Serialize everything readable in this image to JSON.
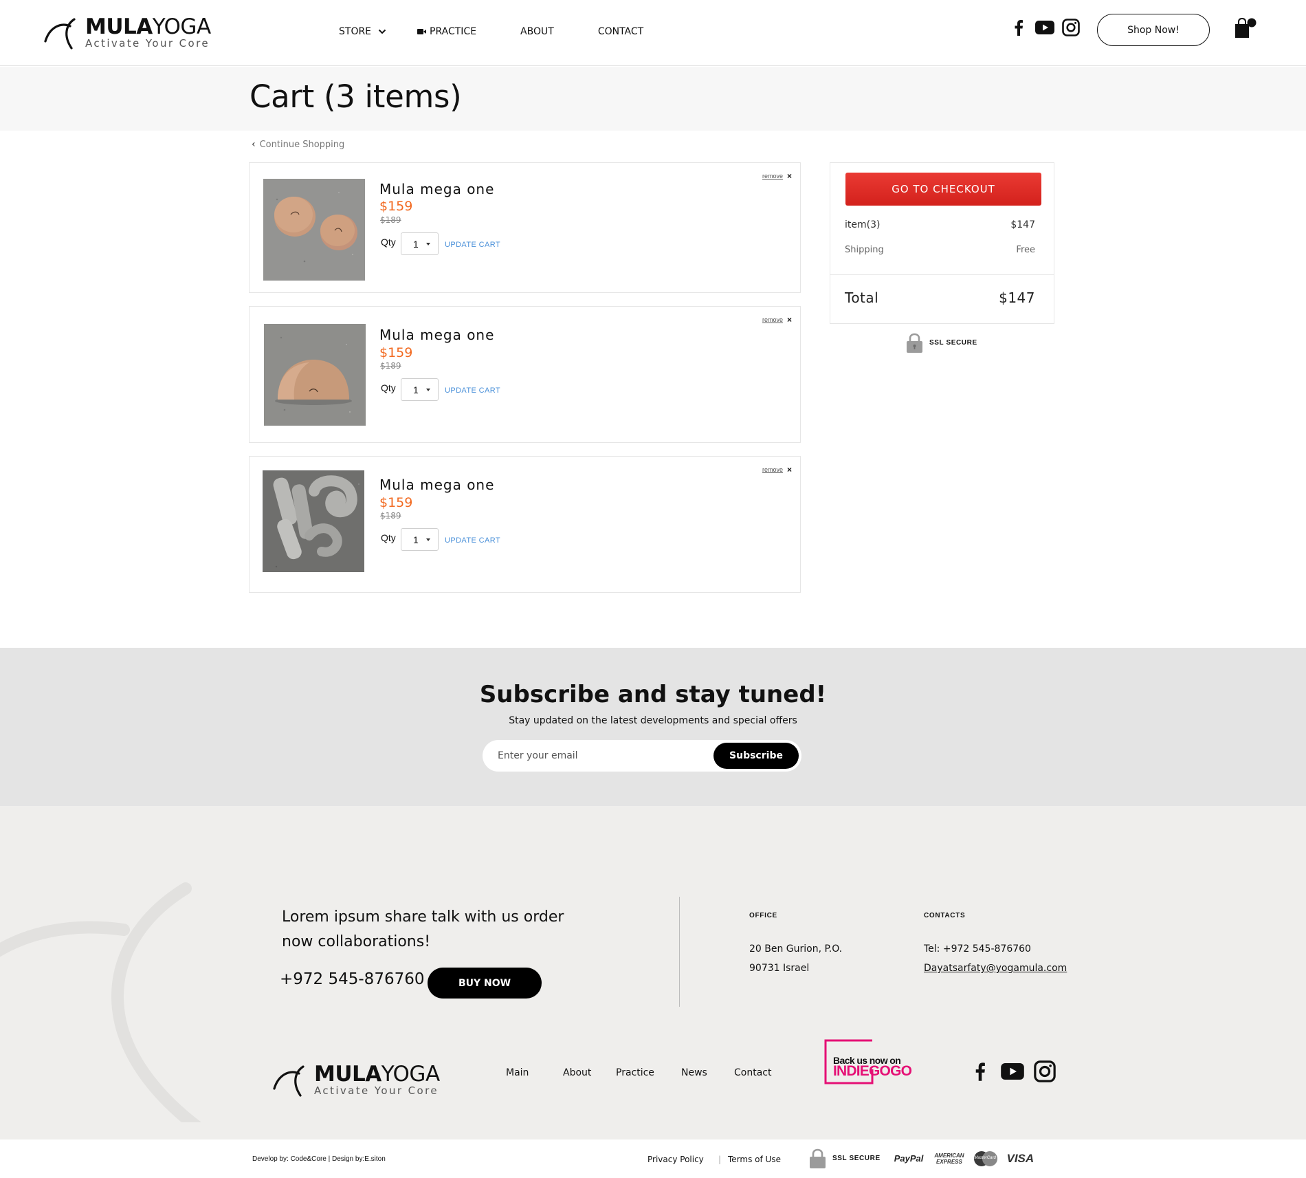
{
  "header": {
    "logo": {
      "brand_bold": "MULA",
      "brand_light": "YOGA",
      "tagline": "Activate Your Core"
    },
    "nav": {
      "store": "STORE",
      "practice": "PRACTICE",
      "about": "ABOUT",
      "contact": "CONTACT"
    },
    "social_icons": [
      "facebook-icon",
      "youtube-icon",
      "instagram-icon"
    ],
    "shop_button": "Shop Now!",
    "cart_icon": "shopping-bag-icon"
  },
  "cart": {
    "title": "Cart (3 items)",
    "continue_label": "Continue Shopping",
    "items": [
      {
        "name": "Mula mega one",
        "price": "$159",
        "old_price": "$189",
        "qty_label": "Qty",
        "qty": "1",
        "update_label": "UPDATE CART",
        "remove_label": "remove",
        "remove_icon": "×",
        "image": "cork balls on concrete"
      },
      {
        "name": "Mula mega one",
        "price": "$159",
        "old_price": "$189",
        "qty_label": "Qty",
        "qty": "1",
        "update_label": "UPDATE CART",
        "remove_label": "remove",
        "remove_icon": "×",
        "image": "cork half-moon block on concrete"
      },
      {
        "name": "Mula mega one",
        "price": "$159",
        "old_price": "$189",
        "qty_label": "Qty",
        "qty": "1",
        "update_label": "UPDATE CART",
        "remove_label": "remove",
        "remove_icon": "×",
        "image": "grey fabric bolsters on concrete"
      }
    ]
  },
  "summary": {
    "checkout_label": "GO TO CHECKOUT",
    "items_label": "item(3)",
    "items_value": "$147",
    "shipping_label": "Shipping",
    "shipping_value": "Free",
    "total_label": "Total",
    "total_value": "$147",
    "ssl_label": "SSL SECURE"
  },
  "subscribe": {
    "title": "Subscribe and stay tuned!",
    "description": "Stay updated on the latest developments and special offers",
    "email_placeholder": "Enter your email",
    "button_label": "Subscribe"
  },
  "footer": {
    "lead_text": "Lorem ipsum share talk with us order now collaborations!",
    "phone": "+972 545-876760",
    "buy_label": "BUY NOW",
    "office_heading": "OFFICE",
    "office_line1": "20 Ben Gurion, P.O.",
    "office_line2": "90731 Israel",
    "contacts_heading": "CONTACTS",
    "contacts_tel": "Tel: +972 545-876760",
    "contacts_email": "Dayatsarfaty@yogamula.com",
    "nav": [
      "Main",
      "About",
      "Practice",
      "News",
      "Contact"
    ],
    "indiegogo_line1": "Back us now on",
    "indiegogo_line2": "INDIEGOGO"
  },
  "bottom": {
    "credit": "Develop by: Code&Core | Design by:E.siton",
    "privacy": "Privacy Policy",
    "separator": "|",
    "terms": "Terms of Use",
    "ssl_label": "SSL SECURE",
    "payments": {
      "paypal": "PayPal",
      "amex_line1": "AMERICAN",
      "amex_line2": "EXPRESS",
      "mastercard": "MasterCard",
      "visa": "VISA"
    }
  },
  "colors": {
    "accent_orange": "#f26a21",
    "checkout_red": "#e0302b",
    "update_blue": "#4a90d9",
    "indiegogo_pink": "#e51075"
  }
}
